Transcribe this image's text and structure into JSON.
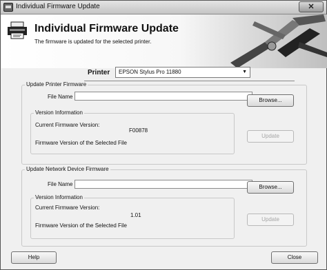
{
  "window": {
    "title": "Individual Firmware Update",
    "close_symbol": "✕"
  },
  "header": {
    "title": "Individual Firmware Update",
    "subtitle": "The firmware is updated for the selected printer.",
    "icon": "printer-icon"
  },
  "printer": {
    "label": "Printer",
    "selected": "EPSON Stylus Pro 11880",
    "arrow": "▼"
  },
  "printer_firmware": {
    "legend": "Update Printer Firmware",
    "file_name_label": "File Name",
    "file_name_value": "",
    "browse_label": "Browse...",
    "version_legend": "Version Information",
    "current_label": "Current Firmware Version:",
    "current_value": "F00878",
    "selected_label": "Firmware Version of the Selected File",
    "update_label": "Update"
  },
  "network_firmware": {
    "legend": "Update Network Device Firmware",
    "file_name_label": "File Name",
    "file_name_value": "",
    "browse_label": "Browse...",
    "version_legend": "Version Information",
    "current_label": "Current Firmware Version:",
    "current_value": "1.01",
    "selected_label": "Firmware Version of the Selected File",
    "update_label": "Update"
  },
  "footer": {
    "help_label": "Help",
    "close_label": "Close"
  }
}
